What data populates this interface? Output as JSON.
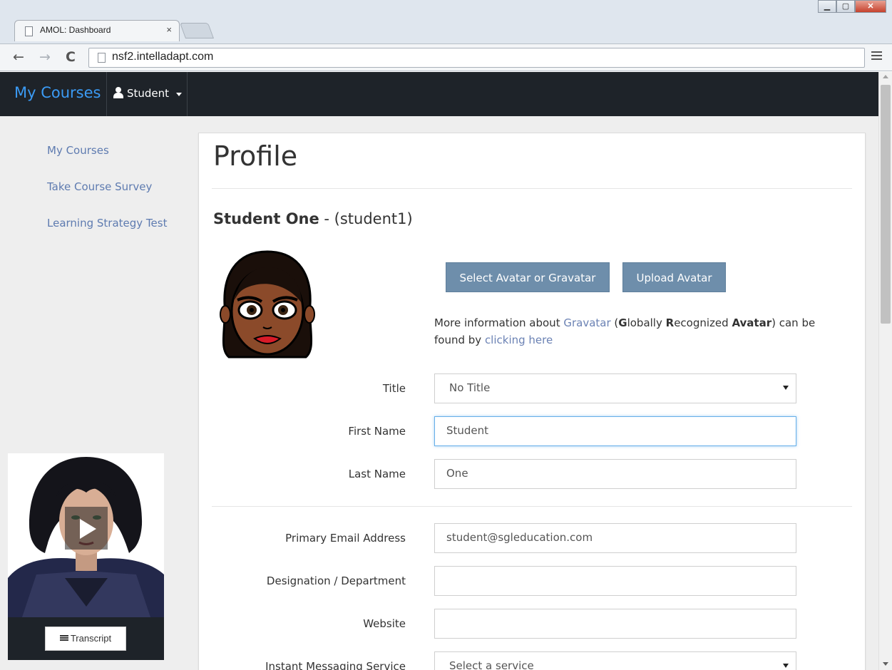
{
  "browser": {
    "tab_title": "AMOL: Dashboard",
    "tab_close": "×",
    "url": "nsf2.intelladapt.com",
    "window_buttons": [
      "minimize",
      "maximize",
      "close"
    ]
  },
  "navbar": {
    "brand": "My Courses",
    "user_label": "Student"
  },
  "sidebar": {
    "items": [
      {
        "label": "My Courses"
      },
      {
        "label": "Take Course Survey"
      },
      {
        "label": "Learning Strategy Test"
      }
    ]
  },
  "profile": {
    "title": "Profile",
    "name": "Student One",
    "username": "- (student1)",
    "select_avatar_label": "Select Avatar or Gravatar",
    "upload_avatar_label": "Upload Avatar",
    "info": {
      "prefix": "More information about ",
      "gravatar_link": "Gravatar",
      "open_paren": " (",
      "g": "G",
      "lobally": "lobally ",
      "r": "R",
      "ecognized": "ecognized ",
      "avatar_bold": "Avatar",
      "suffix": ") can be found by ",
      "clicking_link": "clicking here"
    },
    "fields": {
      "title_label": "Title",
      "title_value": "No Title",
      "first_name_label": "First Name",
      "first_name_value": "Student",
      "last_name_label": "Last Name",
      "last_name_value": "One",
      "email_label": "Primary Email Address",
      "email_value": "student@sgleducation.com",
      "designation_label": "Designation / Department",
      "designation_value": "",
      "website_label": "Website",
      "website_value": "",
      "im_label": "Instant Messaging Service",
      "im_value": "Select a service"
    }
  },
  "video": {
    "transcript_label": "Transcript"
  },
  "colors": {
    "navbar_bg": "#1e2329",
    "brand": "#3b9bf5",
    "link": "#6b82b4",
    "button": "#6e8eab",
    "page_bg": "#eeeeee"
  }
}
